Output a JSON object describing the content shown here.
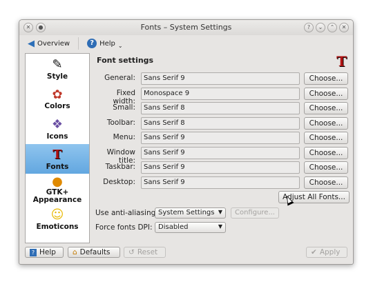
{
  "window": {
    "title": "Fonts – System Settings"
  },
  "toolbar": {
    "overview_label": "Overview",
    "help_label": "Help"
  },
  "sidebar": {
    "items": [
      {
        "label": "Style",
        "icon": "style-icon",
        "active": false
      },
      {
        "label": "Colors",
        "icon": "colors-icon",
        "active": false
      },
      {
        "label": "Icons",
        "icon": "icons-icon",
        "active": false
      },
      {
        "label": "Fonts",
        "icon": "fonts-icon",
        "active": true
      },
      {
        "label": "GTK+\nAppearance",
        "icon": "gtk-icon",
        "active": false
      },
      {
        "label": "Emoticons",
        "icon": "emoticons-icon",
        "active": false
      }
    ]
  },
  "content": {
    "heading": "Font settings",
    "logo_glyph": "T",
    "rows": [
      {
        "label": "General:",
        "value": "Sans Serif 9",
        "button": "Choose..."
      },
      {
        "label": "Fixed width:",
        "value": "Monospace  9",
        "button": "Choose..."
      },
      {
        "label": "Small:",
        "value": "Sans Serif 8",
        "button": "Choose..."
      },
      {
        "label": "Toolbar:",
        "value": "Sans Serif 8",
        "button": "Choose..."
      },
      {
        "label": "Menu:",
        "value": "Sans Serif 9",
        "button": "Choose..."
      },
      {
        "label": "Window title:",
        "value": "Sans Serif 9",
        "button": "Choose..."
      },
      {
        "label": "Taskbar:",
        "value": "Sans Serif 9",
        "button": "Choose..."
      },
      {
        "label": "Desktop:",
        "value": "Sans Serif 9",
        "button": "Choose..."
      }
    ],
    "adjust_label": "Adjust All Fonts...",
    "antialias_label": "Use anti-aliasing:",
    "antialias_value": "System Settings",
    "configure_label": "Configure...",
    "dpi_label": "Force fonts DPI:",
    "dpi_value": "Disabled"
  },
  "bottom": {
    "help_label": "Help",
    "defaults_label": "Defaults",
    "reset_label": "Reset",
    "apply_label": "Apply"
  }
}
